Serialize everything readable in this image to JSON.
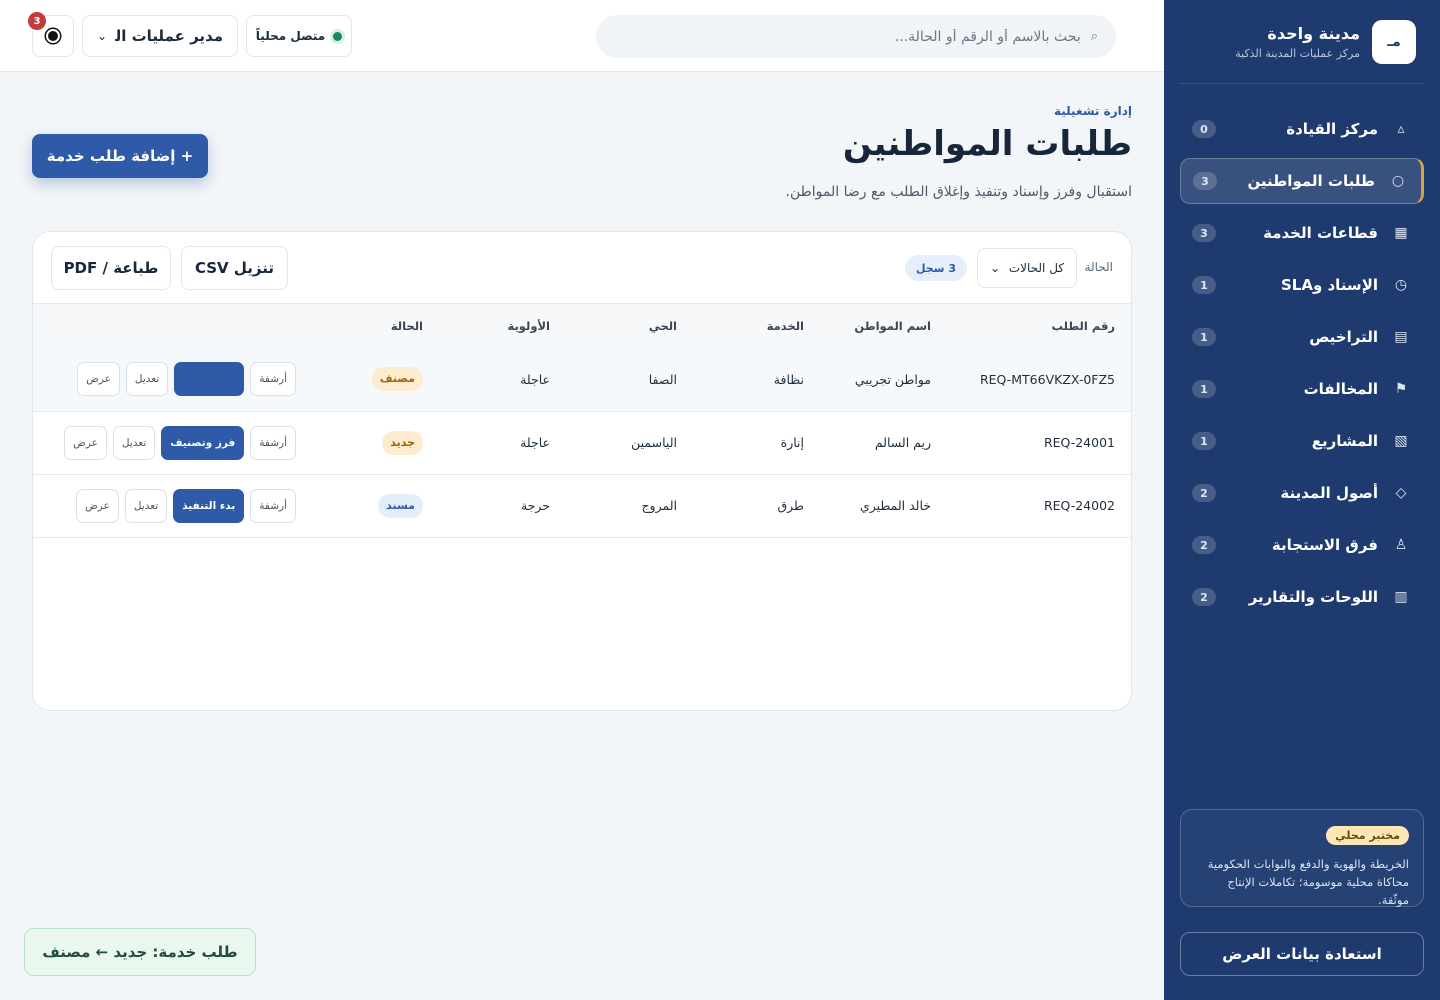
{
  "brand": {
    "logo": "مـ",
    "title": "مدينة واحدة",
    "subtitle": "مركز عمليات المدينة الذكية"
  },
  "sidebar": {
    "items": [
      {
        "label": "مركز القيادة",
        "count": "0",
        "icon": "triangle-icon",
        "glyph": "▵"
      },
      {
        "label": "طلبات المواطنين",
        "count": "3",
        "icon": "circle-icon",
        "glyph": "○"
      },
      {
        "label": "قطاعات الخدمة",
        "count": "3",
        "icon": "grid-icon",
        "glyph": "▦"
      },
      {
        "label": "الإسناد وSLA",
        "count": "1",
        "icon": "clock-icon",
        "glyph": "◷"
      },
      {
        "label": "التراخيص",
        "count": "1",
        "icon": "document-icon",
        "glyph": "▤"
      },
      {
        "label": "المخالفات",
        "count": "1",
        "icon": "flag-icon",
        "glyph": "⚑"
      },
      {
        "label": "المشاريع",
        "count": "1",
        "icon": "hatched-square-icon",
        "glyph": "▧"
      },
      {
        "label": "أصول المدينة",
        "count": "2",
        "icon": "diamond-icon",
        "glyph": "◇"
      },
      {
        "label": "فرق الاستجابة",
        "count": "2",
        "icon": "people-icon",
        "glyph": "♙"
      },
      {
        "label": "اللوحات والتقارير",
        "count": "2",
        "icon": "bars-icon",
        "glyph": "▥"
      }
    ],
    "active_index": 1,
    "lab": {
      "badge": "مختبر محلي",
      "text": "الخريطة والهوية والدفع والبوابات الحكومية محاكاة محلية موسومة؛ تكاملات الإنتاج موثّقة."
    },
    "restore_label": "استعادة بيانات العرض"
  },
  "topbar": {
    "search_placeholder": "بحث بالاسم أو الرقم أو الحالة...",
    "online_label": "متصل محلياً",
    "role_value": "مدير عمليات المد",
    "notif_count": "3"
  },
  "page": {
    "eyebrow": "إدارة تشغيلية",
    "title": "طلبات المواطنين",
    "subtitle": "استقبال وفرز وإسناد وتنفيذ وإغلاق الطلب مع رضا المواطن.",
    "add_label": "+ إضافة طلب خدمة"
  },
  "toolbar": {
    "filter_label": "الحالة",
    "filter_value": "كل الحالات",
    "records": "3 سجل",
    "csv_label": "تنزيل CSV",
    "pdf_label": "طباعة / PDF"
  },
  "table": {
    "headers": [
      "رقم الطلب",
      "اسم المواطن",
      "الخدمة",
      "الحي",
      "الأولوية",
      "الحالة"
    ],
    "rows": [
      {
        "id": "REQ-MT66VKZX-0FZ5",
        "name": "مواطن تجريبي",
        "service": "نظافة",
        "hood": "الصفا",
        "priority": "عاجلة",
        "status": "مصنف",
        "view": "عرض",
        "edit": "تعديل",
        "primary": "",
        "archive": "أرشفة"
      },
      {
        "id": "REQ-24001",
        "name": "ريم السالم",
        "service": "إنارة",
        "hood": "الياسمين",
        "priority": "عاجلة",
        "status": "جديد",
        "view": "عرض",
        "edit": "تعديل",
        "primary": "فرز وتصنيف",
        "archive": "أرشفة"
      },
      {
        "id": "REQ-24002",
        "name": "خالد المطيري",
        "service": "طرق",
        "hood": "المروج",
        "priority": "حرجة",
        "status": "مسند",
        "view": "عرض",
        "edit": "تعديل",
        "primary": "بدء التنفيذ",
        "archive": "أرشفة"
      }
    ]
  },
  "toast": {
    "text": "طلب خدمة: جديد ← مصنف"
  },
  "colors": {
    "sidebar": "#1e3a6e",
    "accent": "#2f5aa8",
    "active_border": "#d9a441",
    "online": "#138a5b"
  }
}
